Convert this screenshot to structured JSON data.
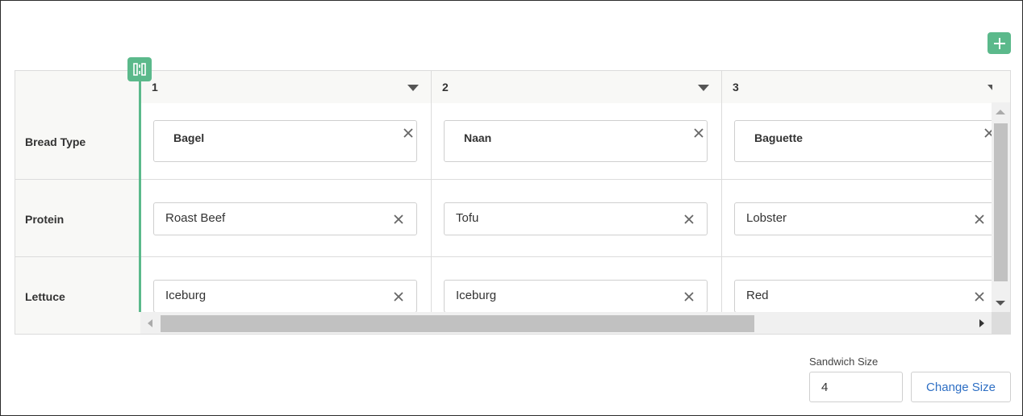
{
  "toolbar": {
    "add_icon": "plus-icon"
  },
  "columns": [
    {
      "label": "1"
    },
    {
      "label": "2"
    },
    {
      "label": "3"
    }
  ],
  "rows": [
    {
      "label": "Bread Type",
      "values": [
        "Bagel",
        "Naan",
        "Baguette"
      ]
    },
    {
      "label": "Protein",
      "values": [
        "Roast Beef",
        "Tofu",
        "Lobster"
      ]
    },
    {
      "label": "Lettuce",
      "values": [
        "Iceburg",
        "Iceburg",
        "Red"
      ]
    }
  ],
  "size": {
    "label": "Sandwich Size",
    "value": "4",
    "button": "Change Size"
  },
  "colors": {
    "accent": "#5bb98b",
    "link": "#2e6fc4",
    "border": "#dcdcdc"
  }
}
